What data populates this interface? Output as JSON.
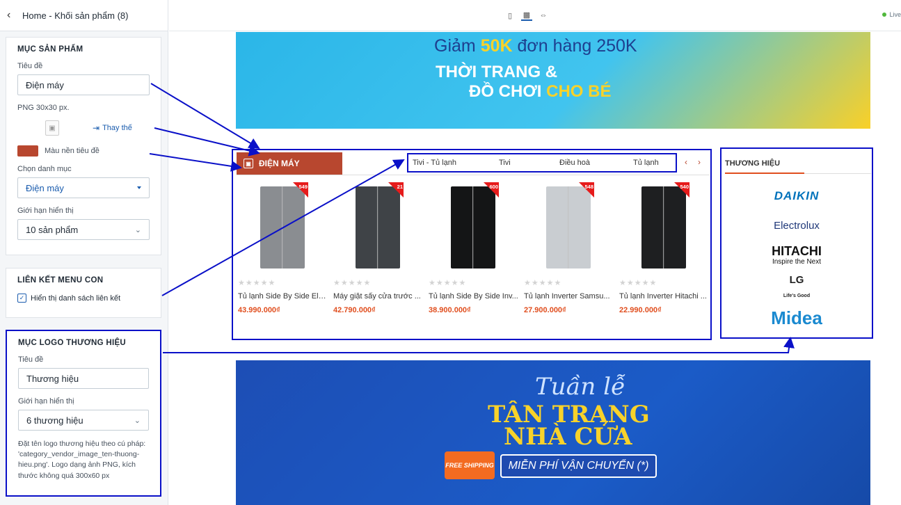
{
  "panel": {
    "header_title": "Home - Khối sản phẩm (8)",
    "product_section": {
      "title": "MỤC SẢN PHẨM",
      "title_label": "Tiêu đề",
      "title_value": "Điện máy",
      "image_hint": "PNG 30x30 px.",
      "replace_label": "Thay thế",
      "bg_color_label": "Màu nền tiêu đề",
      "bg_color": "#b8472f",
      "category_label": "Chọn danh mục",
      "category_value": "Điện máy",
      "limit_label": "Giới hạn hiển thị",
      "limit_value": "10 sản phẩm"
    },
    "submenu_section": {
      "title": "LIÊN KẾT MENU CON",
      "checkbox_label": "Hiển thị danh sách liên kết",
      "checked": true
    },
    "brand_section": {
      "title": "MỤC LOGO THƯƠNG HIỆU",
      "title_label": "Tiêu đề",
      "title_value": "Thương hiệu",
      "limit_label": "Giới hạn hiển thị",
      "limit_value": "6 thương hiệu",
      "note": "Đặt tên logo thương hiệu theo cú pháp: 'category_vendor_image_ten-thuong-hieu.png'. Logo dạng ảnh PNG, kích thước không quá 300x60 px"
    }
  },
  "topbar": {
    "live_label": "Live",
    "devices": [
      "mobile-icon",
      "desktop-icon",
      "fullwidth-icon"
    ]
  },
  "preview": {
    "banner1": {
      "line1_pre": "Giảm ",
      "line1_hl": "50K",
      "line1_post": " đơn hàng 250K",
      "line2": "THỜI TRANG &",
      "line3_pre": "ĐỒ CHƠI ",
      "line3_hl": "CHO BÉ"
    },
    "product_block": {
      "title": "ĐIỆN MÁY",
      "tabs": [
        "Tivi - Tủ lạnh",
        "Tivi",
        "Điều hoà",
        "Tủ lạnh"
      ],
      "products": [
        {
          "name": "Tủ lạnh Side By Side Ele...",
          "price": "43.990.000₫",
          "badge": "549",
          "color": "#8a8d91"
        },
        {
          "name": "Máy giặt sấy cửa trước ...",
          "price": "42.790.000₫",
          "badge": "21",
          "color": "#3f4347"
        },
        {
          "name": "Tủ lạnh Side By Side Inv...",
          "price": "38.900.000₫",
          "badge": "600",
          "color": "#141516"
        },
        {
          "name": "Tủ lạnh Inverter Samsu...",
          "price": "27.900.000₫",
          "badge": "548",
          "color": "#c9cdd1"
        },
        {
          "name": "Tủ lạnh Inverter Hitachi ...",
          "price": "22.990.000₫",
          "badge": "540",
          "color": "#1e1f21"
        }
      ]
    },
    "brand_block": {
      "title": "THƯƠNG HIỆU",
      "brands": {
        "daikin": "DAIKIN",
        "electrolux": "Electrolux",
        "hitachi": "HITACHI",
        "hitachi_sub": "Inspire the Next",
        "lg": "LG",
        "lg_sub": "Life's Good",
        "midea": "Midea"
      }
    },
    "banner2": {
      "line1": "Tuần lễ",
      "line2": "TÂN TRANG",
      "line3": "NHÀ CỬA",
      "free_label": "FREE SHIPPING",
      "pill": "MIỄN PHÍ VẬN CHUYỂN (*)"
    }
  }
}
